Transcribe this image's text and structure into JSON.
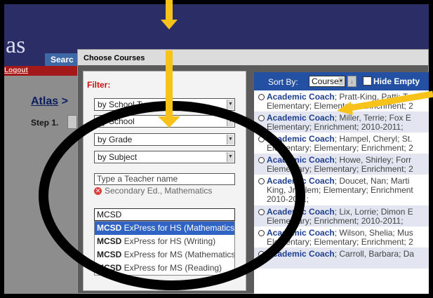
{
  "app": {
    "logo_text": "as",
    "tab_label": "Searc",
    "logout_label": "Logout",
    "breadcrumb_link": "Atlas",
    "breadcrumb_sep": " >",
    "step_label": "Step 1."
  },
  "dialog": {
    "title": "Choose Courses",
    "filter_label": "Filter:",
    "selects": [
      {
        "value": "by School Type"
      },
      {
        "value": "by School"
      },
      {
        "value": "by Grade"
      },
      {
        "value": "by Subject"
      }
    ],
    "teacher_input_placeholder": "Type a Teacher name",
    "selected_filter": "Secondary Ed., Mathematics",
    "search_value": "MCSD",
    "autocomplete": [
      {
        "bold": "MCSD",
        "rest": " ExPress for HS (Mathematics)",
        "selected": true
      },
      {
        "bold": "MCSD",
        "rest": " ExPress for HS (Writing)",
        "selected": false
      },
      {
        "bold": "MCSD",
        "rest": " ExPress for MS (Mathematics)",
        "selected": false
      },
      {
        "bold": "MCSD",
        "rest": " ExPress for MS (Reading)",
        "selected": false
      }
    ]
  },
  "results": {
    "sort_label": "Sort By:",
    "sort_value": "Course",
    "hide_label": "Hide Empty",
    "rows": [
      {
        "course": "Academic Coach",
        "line1": "; Pratt-King, Patti; T",
        "line2": "Elementary; Elementary; Enrichment; 2"
      },
      {
        "course": "Academic Coach",
        "line1": "; Miller, Terrie; Fox E",
        "line2": "Elementary; Enrichment; 2010-2011;"
      },
      {
        "course": "Academic Coach",
        "line1": "; Hampel, Cheryl; St.",
        "line2": "Elementary; Elementary; Enrichment; 2"
      },
      {
        "course": "Academic Coach",
        "line1": "; Howe, Shirley; Forr",
        "line2": "Elementary; Elementary; Enrichment; 2"
      },
      {
        "course": "Academic Coach",
        "line1": "; Doucet, Nan; Marti",
        "line2": "King, Jr. Elem; Elementary; Enrichment",
        "line3": "2010-2011;"
      },
      {
        "course": "Academic Coach",
        "line1": "; Lix, Lorrie; Dimon E",
        "line2": "Elementary; Enrichment; 2010-2011;"
      },
      {
        "course": "Academic Coach",
        "line1": "; Wilson, Shelia; Mus",
        "line2": "Elementary; Elementary; Enrichment; 2"
      },
      {
        "course": "Academic Coach",
        "line1": "; Carroll, Barbara; Da",
        "line2": ""
      }
    ]
  },
  "colors": {
    "arrow": "#f7c31b",
    "header": "#2a2d66",
    "results_header": "#2450a3",
    "selected_item": "#3064c4",
    "filter_label": "#cc1111"
  }
}
